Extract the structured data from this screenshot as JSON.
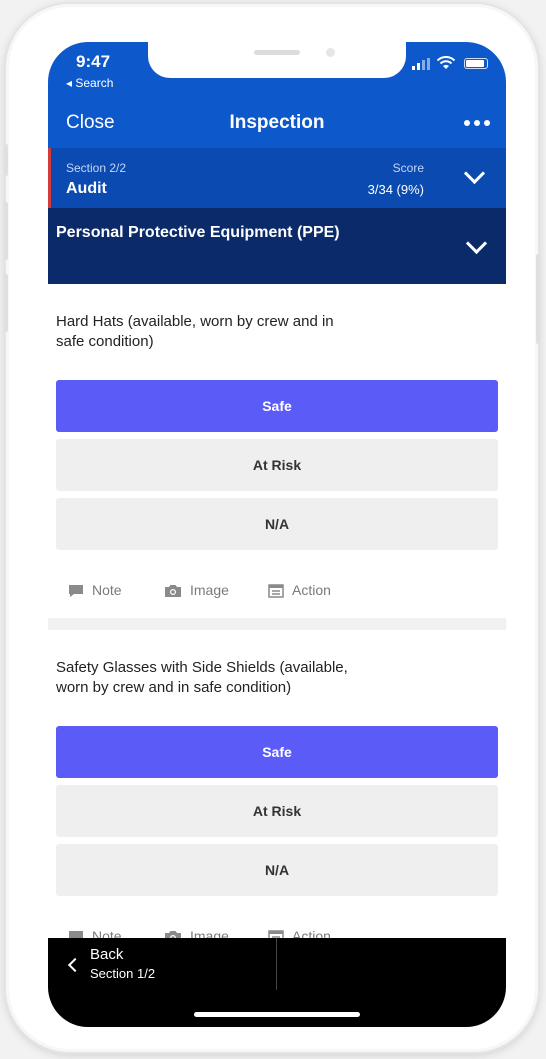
{
  "status_bar": {
    "time": "9:47",
    "back_app": "◂ Search"
  },
  "navbar": {
    "close_label": "Close",
    "title": "Inspection",
    "more_icon": "more-dots-icon"
  },
  "section": {
    "label": "Section 2/2",
    "name": "Audit",
    "score_label": "Score",
    "score_value": "3/34 (9%)"
  },
  "category": {
    "title": "Personal Protective Equipment (PPE)"
  },
  "questions": [
    {
      "text_line1": "Hard Hats (available, worn by crew and in",
      "text_line2": "safe condition)",
      "responses": [
        "Safe",
        "At Risk",
        "N/A"
      ],
      "selected": "Safe",
      "actions": [
        "Note",
        "Image",
        "Action"
      ]
    },
    {
      "text_line1": "Safety Glasses with Side Shields (available,",
      "text_line2": "worn by crew and in safe condition)",
      "responses": [
        "Safe",
        "At Risk",
        "N/A"
      ],
      "selected": "Safe",
      "actions": [
        "Note",
        "Image",
        "Action"
      ]
    }
  ],
  "bottom_nav": {
    "back_label": "Back",
    "back_sub": "Section 1/2"
  },
  "colors": {
    "nav_blue": "#0d59cc",
    "section_blue": "#0b4ab0",
    "category_navy": "#0a2a6a",
    "safe_purple": "#5b5cf8",
    "accent_red": "#d33a3a"
  }
}
